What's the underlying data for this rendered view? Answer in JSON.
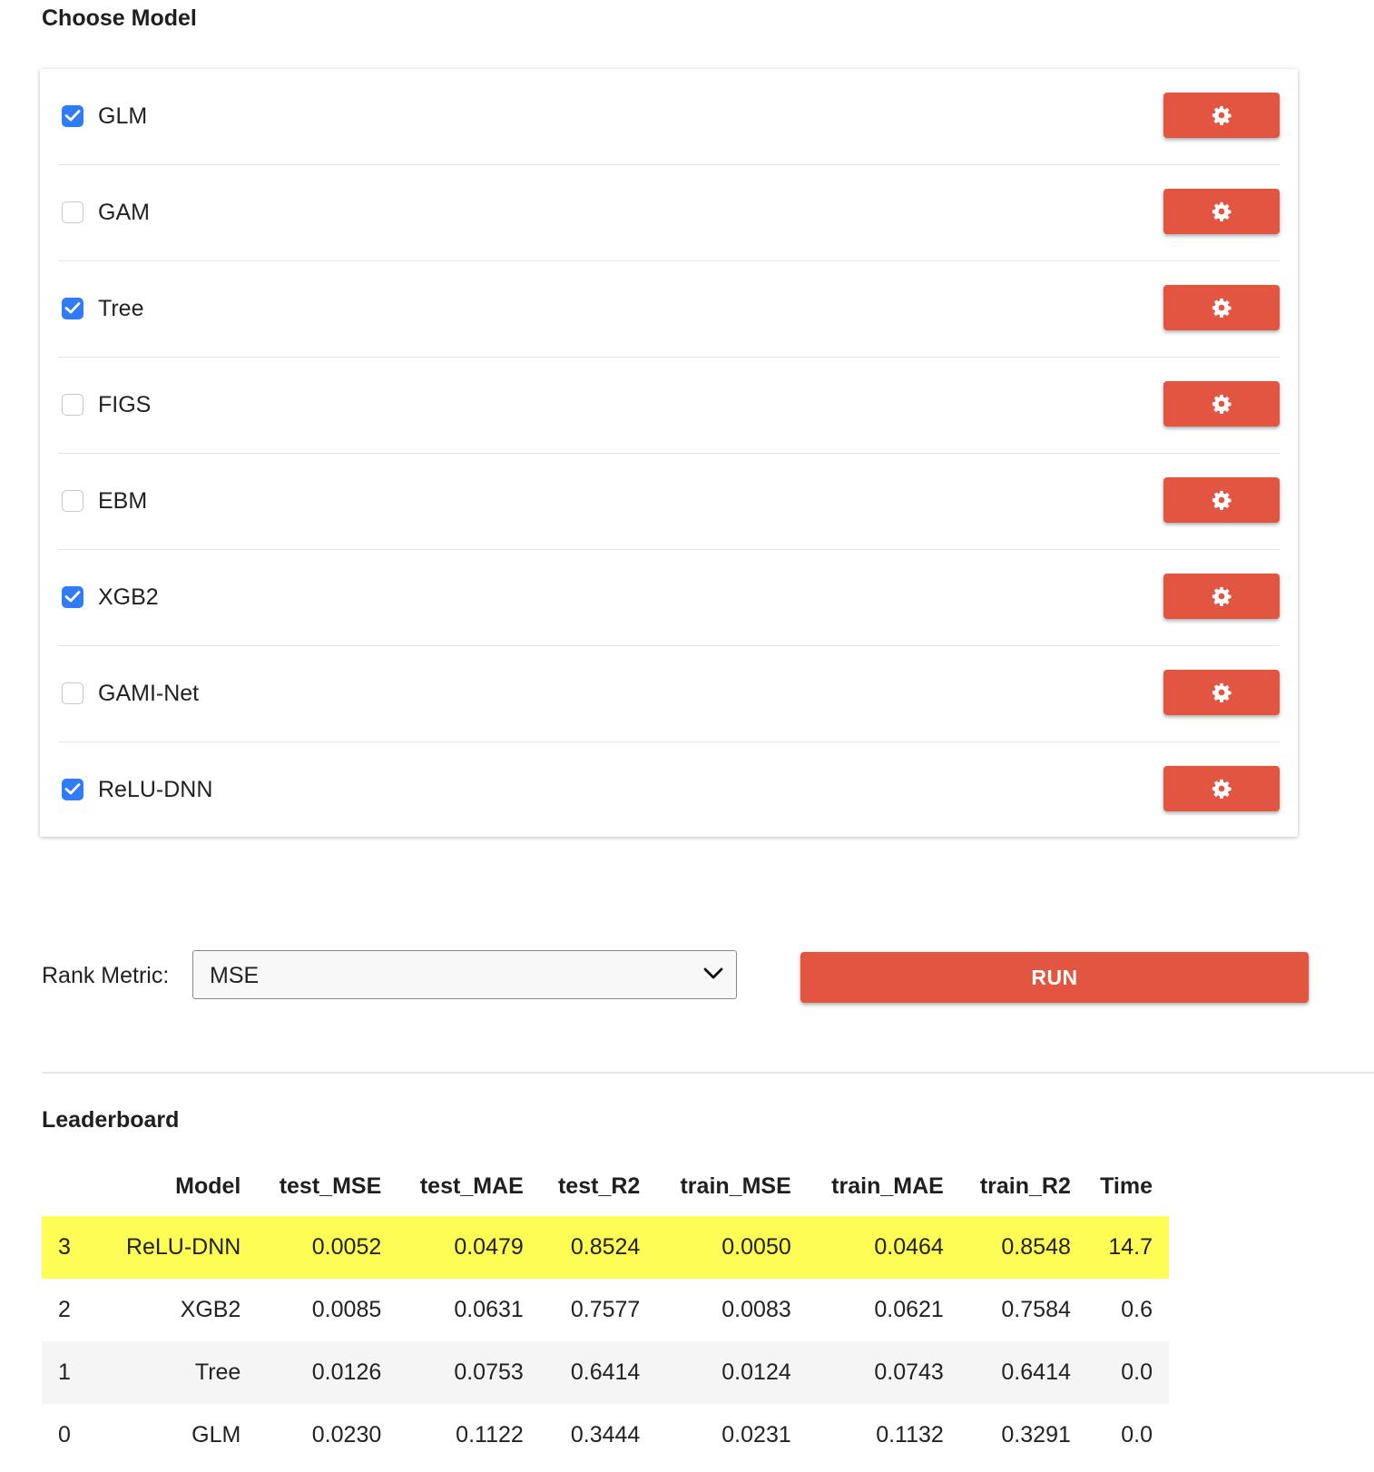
{
  "choose_model": {
    "title": "Choose Model",
    "models": [
      {
        "label": "GLM",
        "checked": true
      },
      {
        "label": "GAM",
        "checked": false
      },
      {
        "label": "Tree",
        "checked": true
      },
      {
        "label": "FIGS",
        "checked": false
      },
      {
        "label": "EBM",
        "checked": false
      },
      {
        "label": "XGB2",
        "checked": true
      },
      {
        "label": "GAMI-Net",
        "checked": false
      },
      {
        "label": "ReLU-DNN",
        "checked": true
      }
    ],
    "settings_icon": "gear-icon"
  },
  "controls": {
    "rank_label": "Rank Metric:",
    "rank_selected": "MSE",
    "run_label": "RUN"
  },
  "leaderboard": {
    "title": "Leaderboard",
    "columns": [
      "",
      "Model",
      "test_MSE",
      "test_MAE",
      "test_R2",
      "train_MSE",
      "train_MAE",
      "train_R2",
      "Time"
    ],
    "rows": [
      [
        "3",
        "ReLU-DNN",
        "0.0052",
        "0.0479",
        "0.8524",
        "0.0050",
        "0.0464",
        "0.8548",
        "14.7"
      ],
      [
        "2",
        "XGB2",
        "0.0085",
        "0.0631",
        "0.7577",
        "0.0083",
        "0.0621",
        "0.7584",
        "0.6"
      ],
      [
        "1",
        "Tree",
        "0.0126",
        "0.0753",
        "0.6414",
        "0.0124",
        "0.0743",
        "0.6414",
        "0.0"
      ],
      [
        "0",
        "GLM",
        "0.0230",
        "0.1122",
        "0.3444",
        "0.0231",
        "0.1132",
        "0.3291",
        "0.0"
      ]
    ],
    "highlight_color": "#fdfd55"
  },
  "colors": {
    "accent": "#e25641",
    "checkbox": "#2f7cf6"
  }
}
